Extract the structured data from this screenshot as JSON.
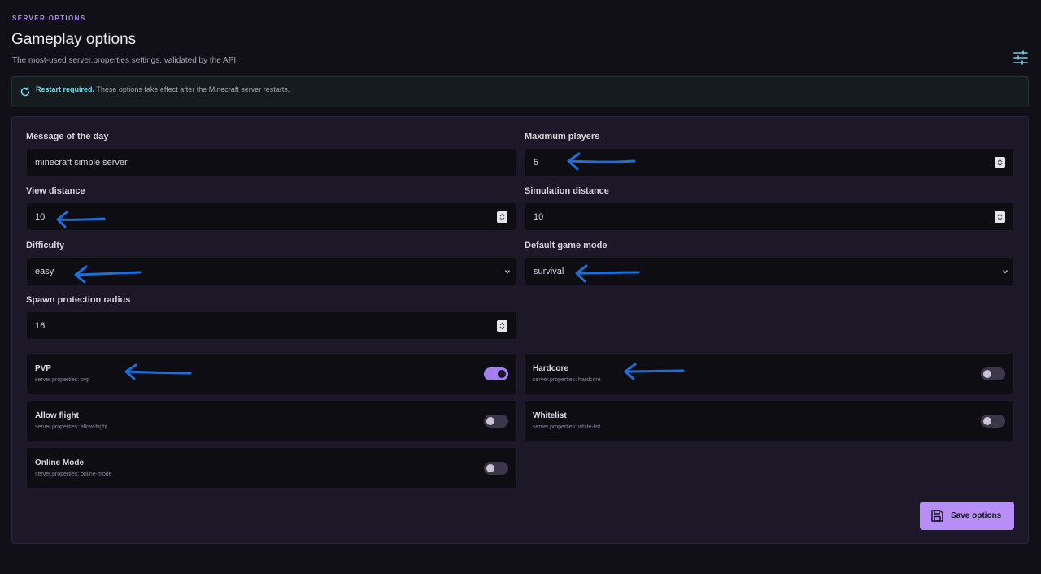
{
  "header": {
    "eyebrow": "SERVER OPTIONS",
    "title": "Gameplay options",
    "subtitle": "The most-used server.properties settings, validated by the API."
  },
  "notice": {
    "strong": "Restart required.",
    "text": " These options take effect after the Minecraft server restarts."
  },
  "fields": {
    "motd": {
      "label": "Message of the day",
      "value": "minecraft simple server"
    },
    "max_players": {
      "label": "Maximum players",
      "value": "5"
    },
    "view_distance": {
      "label": "View distance",
      "value": "10"
    },
    "simulation_distance": {
      "label": "Simulation distance",
      "value": "10"
    },
    "difficulty": {
      "label": "Difficulty",
      "value": "easy"
    },
    "game_mode": {
      "label": "Default game mode",
      "value": "survival"
    },
    "spawn_protection": {
      "label": "Spawn protection radius",
      "value": "16"
    }
  },
  "toggles": {
    "pvp": {
      "title": "PVP",
      "key": "server.properties: pvp",
      "on": true
    },
    "hardcore": {
      "title": "Hardcore",
      "key": "server.properties: hardcore",
      "on": false
    },
    "allow_flight": {
      "title": "Allow flight",
      "key": "server.properties: allow-flight",
      "on": false
    },
    "whitelist": {
      "title": "Whitelist",
      "key": "server.properties: white-list",
      "on": false
    },
    "online_mode": {
      "title": "Online Mode",
      "key": "server.properties: online-mode",
      "on": false
    }
  },
  "actions": {
    "save_label": "Save options"
  },
  "icons": {
    "settings": "sliders-icon",
    "restart": "refresh-icon",
    "save": "floppy-disk-icon",
    "select": "chevron-down-icon",
    "spinner": "spinner-arrows-icon",
    "annotation": "arrow-left-annotation"
  },
  "colors": {
    "accent": "#b78ef6",
    "toggle_on": "#a47ff0",
    "notice_strong": "#7fd8e2",
    "annotation_arrow": "#1b6fd6"
  }
}
